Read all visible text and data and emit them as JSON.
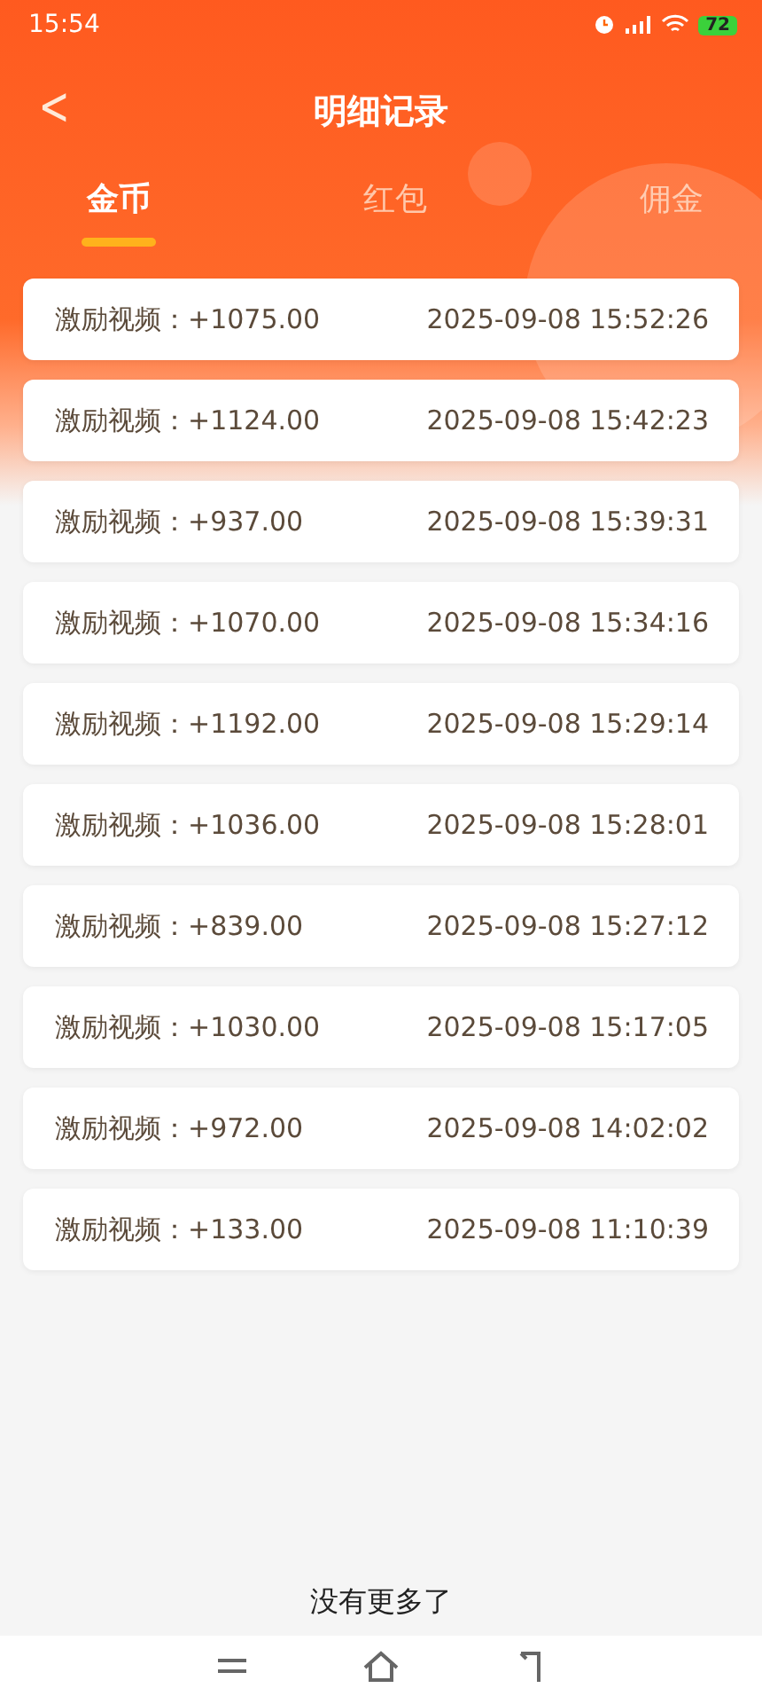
{
  "status_bar": {
    "time": "15:54",
    "battery": "72"
  },
  "header": {
    "back": "<",
    "title": "明细记录"
  },
  "tabs": [
    {
      "label": "金币",
      "selected": true
    },
    {
      "label": "红包",
      "selected": false
    },
    {
      "label": "佣金",
      "selected": false
    }
  ],
  "records": [
    {
      "label": "激励视频：+1075.00",
      "time": "2025-09-08 15:52:26"
    },
    {
      "label": "激励视频：+1124.00",
      "time": "2025-09-08 15:42:23"
    },
    {
      "label": "激励视频：+937.00",
      "time": "2025-09-08 15:39:31"
    },
    {
      "label": "激励视频：+1070.00",
      "time": "2025-09-08 15:34:16"
    },
    {
      "label": "激励视频：+1192.00",
      "time": "2025-09-08 15:29:14"
    },
    {
      "label": "激励视频：+1036.00",
      "time": "2025-09-08 15:28:01"
    },
    {
      "label": "激励视频：+839.00",
      "time": "2025-09-08 15:27:12"
    },
    {
      "label": "激励视频：+1030.00",
      "time": "2025-09-08 15:17:05"
    },
    {
      "label": "激励视频：+972.00",
      "time": "2025-09-08 14:02:02"
    },
    {
      "label": "激励视频：+133.00",
      "time": "2025-09-08 11:10:39"
    }
  ],
  "footer": "没有更多了"
}
